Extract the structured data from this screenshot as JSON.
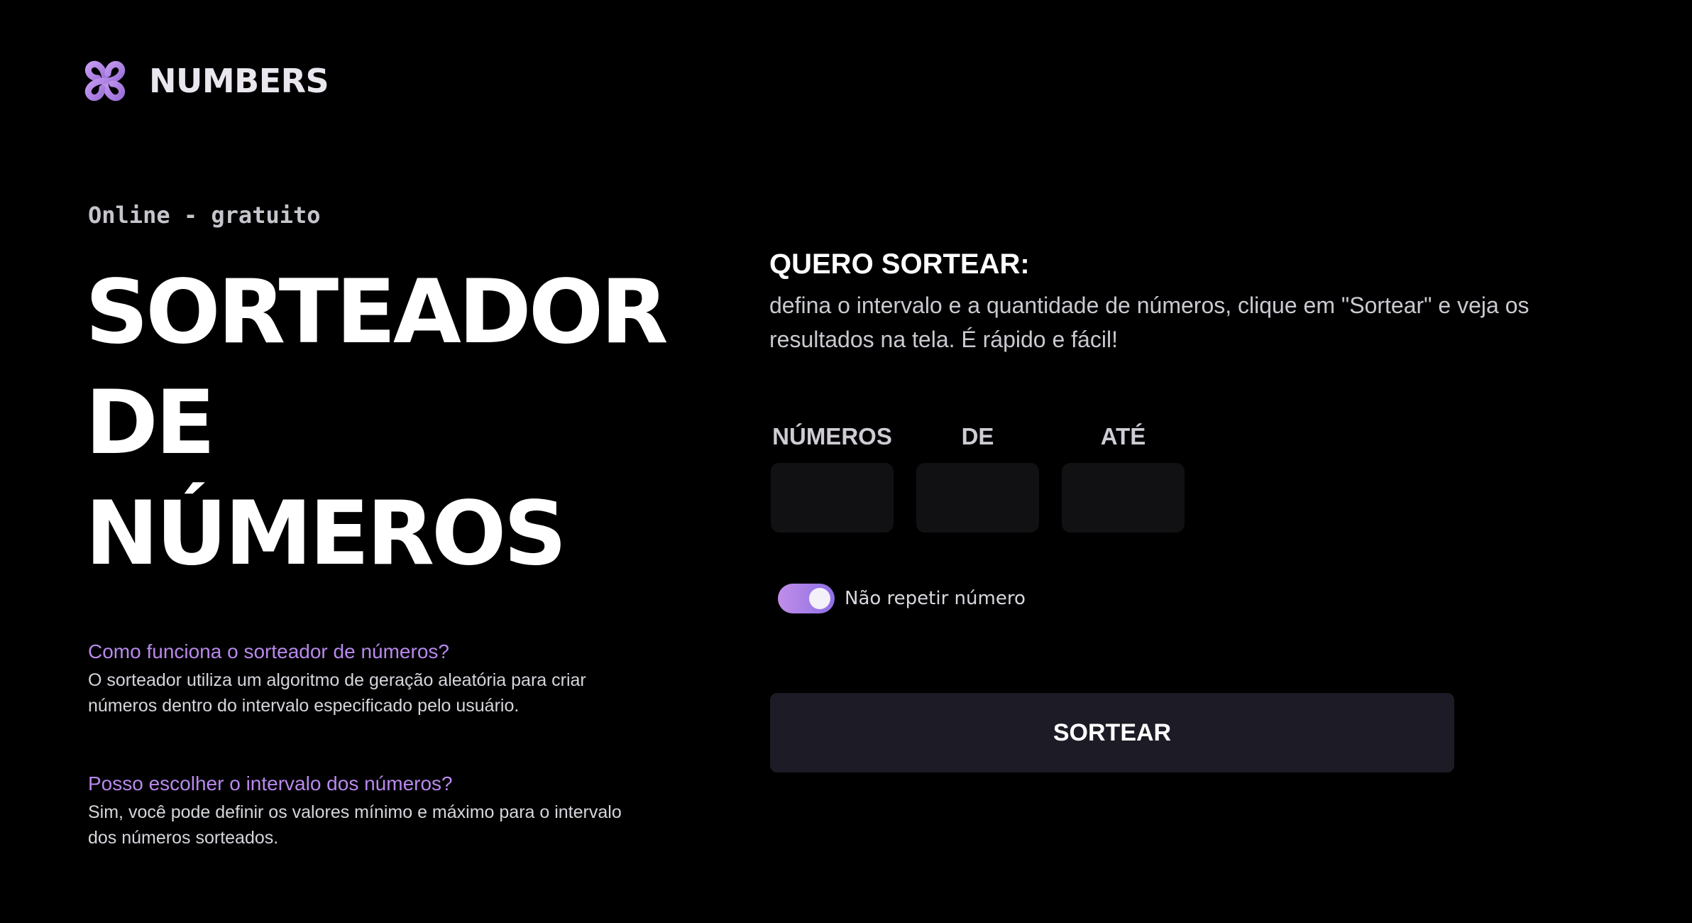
{
  "brand": {
    "icon": "knot-logo-icon",
    "name": "NUMBERS",
    "accent_color": "#b889ec"
  },
  "hero": {
    "tagline": "Online - gratuito",
    "title_lines": [
      "SORTEADOR",
      "DE",
      "NÚMEROS"
    ]
  },
  "faq": [
    {
      "question": "Como funciona o sorteador de números?",
      "answer": "O sorteador utiliza um algoritmo de geração aleatória para criar números dentro do intervalo especificado pelo usuário."
    },
    {
      "question": "Posso escolher o intervalo dos números?",
      "answer": "Sim, você pode definir os valores mínimo e máximo para o intervalo dos números sorteados."
    }
  ],
  "draw": {
    "heading": "QUERO SORTEAR:",
    "description": "defina o intervalo e a quantidade de números, clique em \"Sortear\" e veja os resultados na tela. É rápido e fácil!",
    "fields": [
      {
        "label": "NÚMEROS",
        "value": "",
        "placeholder": ""
      },
      {
        "label": "DE",
        "value": "",
        "placeholder": ""
      },
      {
        "label": "ATÉ",
        "value": "",
        "placeholder": ""
      }
    ],
    "no_repeat": {
      "label": "Não repetir número",
      "checked": true
    },
    "button_label": "SORTEAR"
  }
}
